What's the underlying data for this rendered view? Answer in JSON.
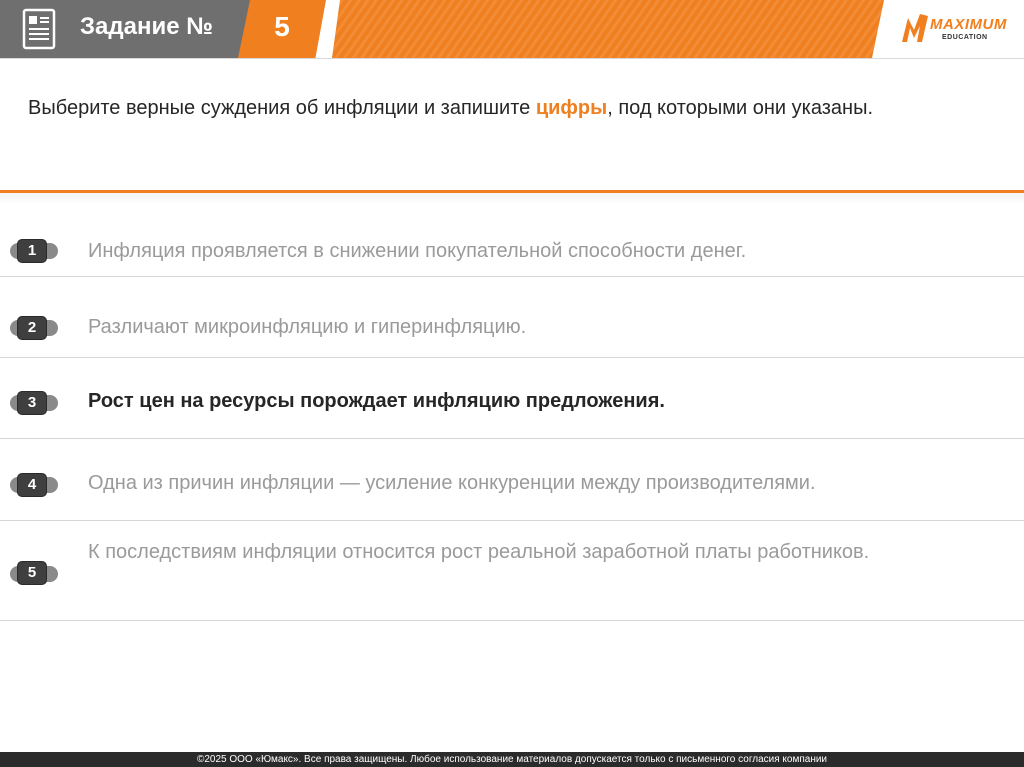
{
  "header": {
    "title": "Задание №",
    "number": "5",
    "logo_word": "MAXIMUM",
    "logo_sub": "EDUCATION",
    "icons": {
      "document": "document-icon",
      "logo_mark": "maximum-logo-mark-icon"
    }
  },
  "question": {
    "part1": "Выберите верные суждения об инфляции и запишите ",
    "highlight": "цифры",
    "part2": ", под которыми они указаны."
  },
  "options": [
    {
      "num": "1",
      "text": "Инфляция проявляется в снижении покупательной способности денег.",
      "bold": false
    },
    {
      "num": "2",
      "text": "Различают микроинфляцию и гиперинфляцию.",
      "bold": false
    },
    {
      "num": "3",
      "text": "Рост цен на ресурсы порождает инфляцию предложения.",
      "bold": true
    },
    {
      "num": "4",
      "text": "Одна из причин инфляции — усиление конкуренции между производителями.",
      "bold": false
    },
    {
      "num": "5",
      "text": "К последствиям инфляции относится рост реальной заработной платы работников.",
      "bold": false
    }
  ],
  "footer": {
    "text": "©2025 ООО «Юмакс». Все права защищены. Любое использование материалов допускается только с письменного согласия компании"
  },
  "colors": {
    "accent": "#f07f1f",
    "header_gray": "#6f6f6f",
    "badge": "#3f3f3f",
    "footer_bg": "#2b2b2b"
  }
}
